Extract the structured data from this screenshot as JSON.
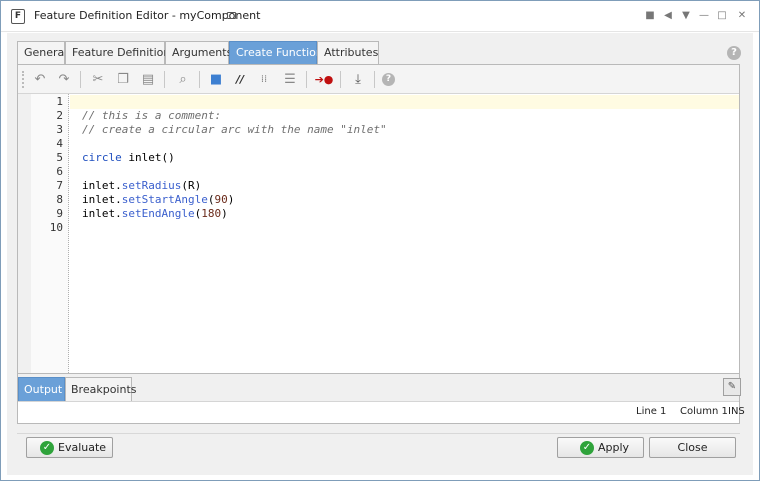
{
  "window": {
    "title": "Feature Definition Editor - myComponent",
    "app_icon_glyph": "F"
  },
  "titlebar_controls": [
    {
      "icon": "square-icon",
      "glyph": "■"
    },
    {
      "icon": "arrow-left-icon",
      "glyph": "◀"
    },
    {
      "icon": "arrow-down-icon",
      "glyph": "▼"
    },
    {
      "icon": "minimize-icon",
      "glyph": "—"
    },
    {
      "icon": "maximize-icon",
      "glyph": "□"
    },
    {
      "icon": "close-icon",
      "glyph": "✕"
    }
  ],
  "tabs": [
    {
      "label": "General",
      "active": false
    },
    {
      "label": "Feature Definitions",
      "active": false
    },
    {
      "label": "Arguments",
      "active": false
    },
    {
      "label": "Create Function",
      "active": true
    },
    {
      "label": "Attributes",
      "active": false
    }
  ],
  "help_glyph": "?",
  "toolbar": {
    "buttons": [
      {
        "icon": "undo-icon",
        "glyph": "↶"
      },
      {
        "icon": "redo-icon",
        "glyph": "↷"
      },
      {
        "icon": "cut-icon",
        "glyph": "✂"
      },
      {
        "icon": "copy-icon",
        "glyph": "❐"
      },
      {
        "icon": "paste-icon",
        "glyph": "▤"
      },
      {
        "icon": "find-icon",
        "glyph": "⌕"
      },
      {
        "icon": "folder-icon",
        "glyph": "■"
      },
      {
        "icon": "comment-icon",
        "glyph": "//"
      },
      {
        "icon": "uncomment-icon",
        "glyph": "⁞⁞"
      },
      {
        "icon": "indent-icon",
        "glyph": "☰"
      },
      {
        "icon": "run-breakpoint-icon",
        "glyph": "➔●"
      },
      {
        "icon": "debug-step-icon",
        "glyph": "⤓"
      },
      {
        "icon": "help-icon",
        "glyph": "?"
      }
    ]
  },
  "editor": {
    "line_numbers": [
      "1",
      "2",
      "3",
      "4",
      "5",
      "6",
      "7",
      "8",
      "9",
      "10"
    ],
    "lines": [
      {
        "segments": []
      },
      {
        "segments": [
          {
            "text": "// this is a comment:",
            "cls": "cmt"
          }
        ]
      },
      {
        "segments": [
          {
            "text": "// create a circular arc with the name \"inlet\"",
            "cls": "cmt"
          }
        ]
      },
      {
        "segments": []
      },
      {
        "segments": [
          {
            "text": "circle",
            "cls": "kw"
          },
          {
            "text": " inlet()",
            "cls": ""
          }
        ]
      },
      {
        "segments": []
      },
      {
        "segments": [
          {
            "text": "inlet.",
            "cls": ""
          },
          {
            "text": "setRadius",
            "cls": "fn"
          },
          {
            "text": "(R)",
            "cls": ""
          }
        ]
      },
      {
        "segments": [
          {
            "text": "inlet.",
            "cls": ""
          },
          {
            "text": "setStartAngle",
            "cls": "fn"
          },
          {
            "text": "(",
            "cls": ""
          },
          {
            "text": "90",
            "cls": "num"
          },
          {
            "text": ")",
            "cls": ""
          }
        ]
      },
      {
        "segments": [
          {
            "text": "inlet.",
            "cls": ""
          },
          {
            "text": "setEndAngle",
            "cls": "fn"
          },
          {
            "text": "(",
            "cls": ""
          },
          {
            "text": "180",
            "cls": "num"
          },
          {
            "text": ")",
            "cls": ""
          }
        ]
      },
      {
        "segments": []
      }
    ]
  },
  "bottom_tabs": [
    {
      "label": "Output",
      "active": true
    },
    {
      "label": "Breakpoints",
      "active": false
    }
  ],
  "pin_glyph": "✎",
  "status": {
    "line": "Line 1",
    "column": "Column 1",
    "mode": "INS"
  },
  "buttons": {
    "evaluate": "Evaluate",
    "apply": "Apply",
    "close": "Close",
    "check_glyph": "✓"
  },
  "colors": {
    "active_tab": "#6aa0d8",
    "check_green": "#2fa33b"
  }
}
